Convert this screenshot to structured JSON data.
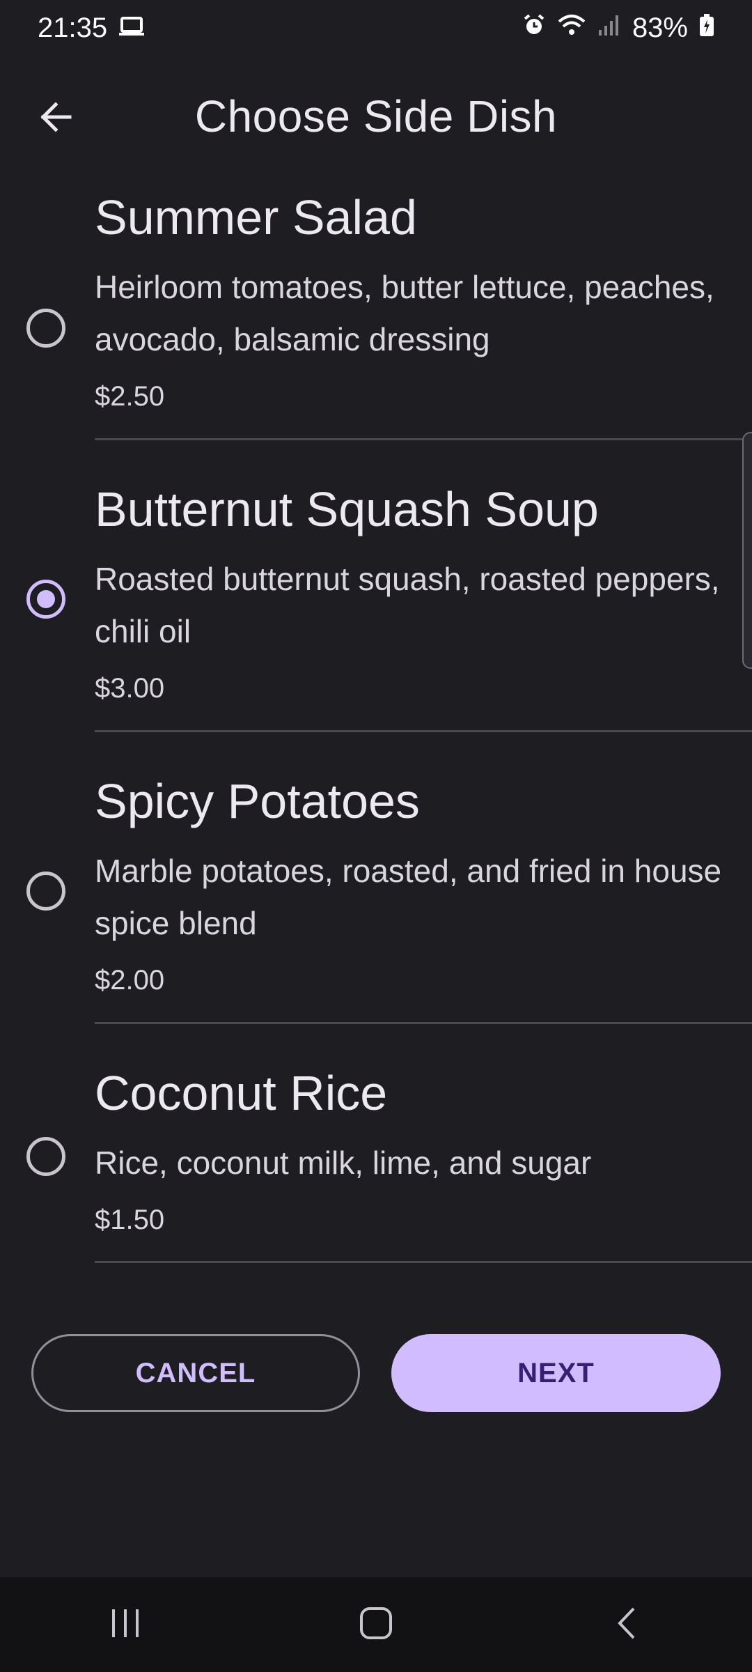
{
  "status_bar": {
    "time": "21:35",
    "battery": "83%",
    "icons": [
      "laptop-icon",
      "alarm-icon",
      "wifi-icon",
      "signal-icon",
      "battery-icon"
    ]
  },
  "header": {
    "title": "Choose Side Dish",
    "back_icon": "arrow-back-icon"
  },
  "items": [
    {
      "name": "Summer Salad",
      "description": "Heirloom tomatoes, butter lettuce, peaches, avocado, balsamic dressing",
      "price": "$2.50",
      "selected": false
    },
    {
      "name": "Butternut Squash Soup",
      "description": "Roasted butternut squash, roasted peppers, chili oil",
      "price": "$3.00",
      "selected": true
    },
    {
      "name": "Spicy Potatoes",
      "description": "Marble potatoes, roasted, and fried in house spice blend",
      "price": "$2.00",
      "selected": false
    },
    {
      "name": "Coconut Rice",
      "description": "Rice, coconut milk, lime, and sugar",
      "price": "$1.50",
      "selected": false
    }
  ],
  "actions": {
    "cancel_label": "CANCEL",
    "next_label": "NEXT"
  },
  "colors": {
    "background": "#1e1d22",
    "accent": "#d0bcff",
    "on_accent": "#381e72"
  },
  "nav_bar": {
    "icons": [
      "recent-apps-icon",
      "home-icon",
      "back-icon"
    ]
  }
}
